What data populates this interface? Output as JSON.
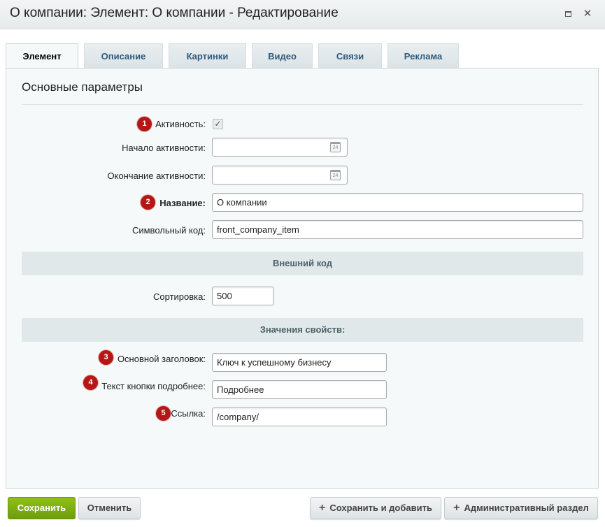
{
  "window": {
    "title": "О компании: Элемент: О компании - Редактирование"
  },
  "tabs": [
    {
      "label": "Элемент"
    },
    {
      "label": "Описание"
    },
    {
      "label": "Картинки"
    },
    {
      "label": "Видео"
    },
    {
      "label": "Связи"
    },
    {
      "label": "Реклама"
    }
  ],
  "form": {
    "section_title": "Основные параметры",
    "active": {
      "label": "Активность:",
      "checked": true,
      "badge": "1"
    },
    "active_from": {
      "label": "Начало активности:",
      "value": "",
      "calendar_text": "24"
    },
    "active_to": {
      "label": "Окончание активности:",
      "value": "",
      "calendar_text": "24"
    },
    "name": {
      "label": "Название:",
      "value": "О компании",
      "badge": "2"
    },
    "code": {
      "label": "Символьный код:",
      "value": "front_company_item"
    },
    "external_code_header": "Внешний код",
    "sort": {
      "label": "Сортировка:",
      "value": "500"
    },
    "properties_header": "Значения свойств:",
    "main_heading": {
      "label": "Основной заголовок:",
      "value": "Ключ к успешному бизнесу",
      "badge": "3"
    },
    "button_text": {
      "label": "Текст кнопки подробнее:",
      "value": "Подробнее",
      "badge": "4"
    },
    "link": {
      "label": "Ссылка:",
      "value": "/company/",
      "badge": "5"
    }
  },
  "footer": {
    "save": "Сохранить",
    "cancel": "Отменить",
    "save_add": "Сохранить и добавить",
    "admin": "Административный раздел"
  },
  "colors": {
    "badge": "#b51717",
    "save_button": "#7aa80f",
    "link_tab": "#2e5a7e"
  }
}
